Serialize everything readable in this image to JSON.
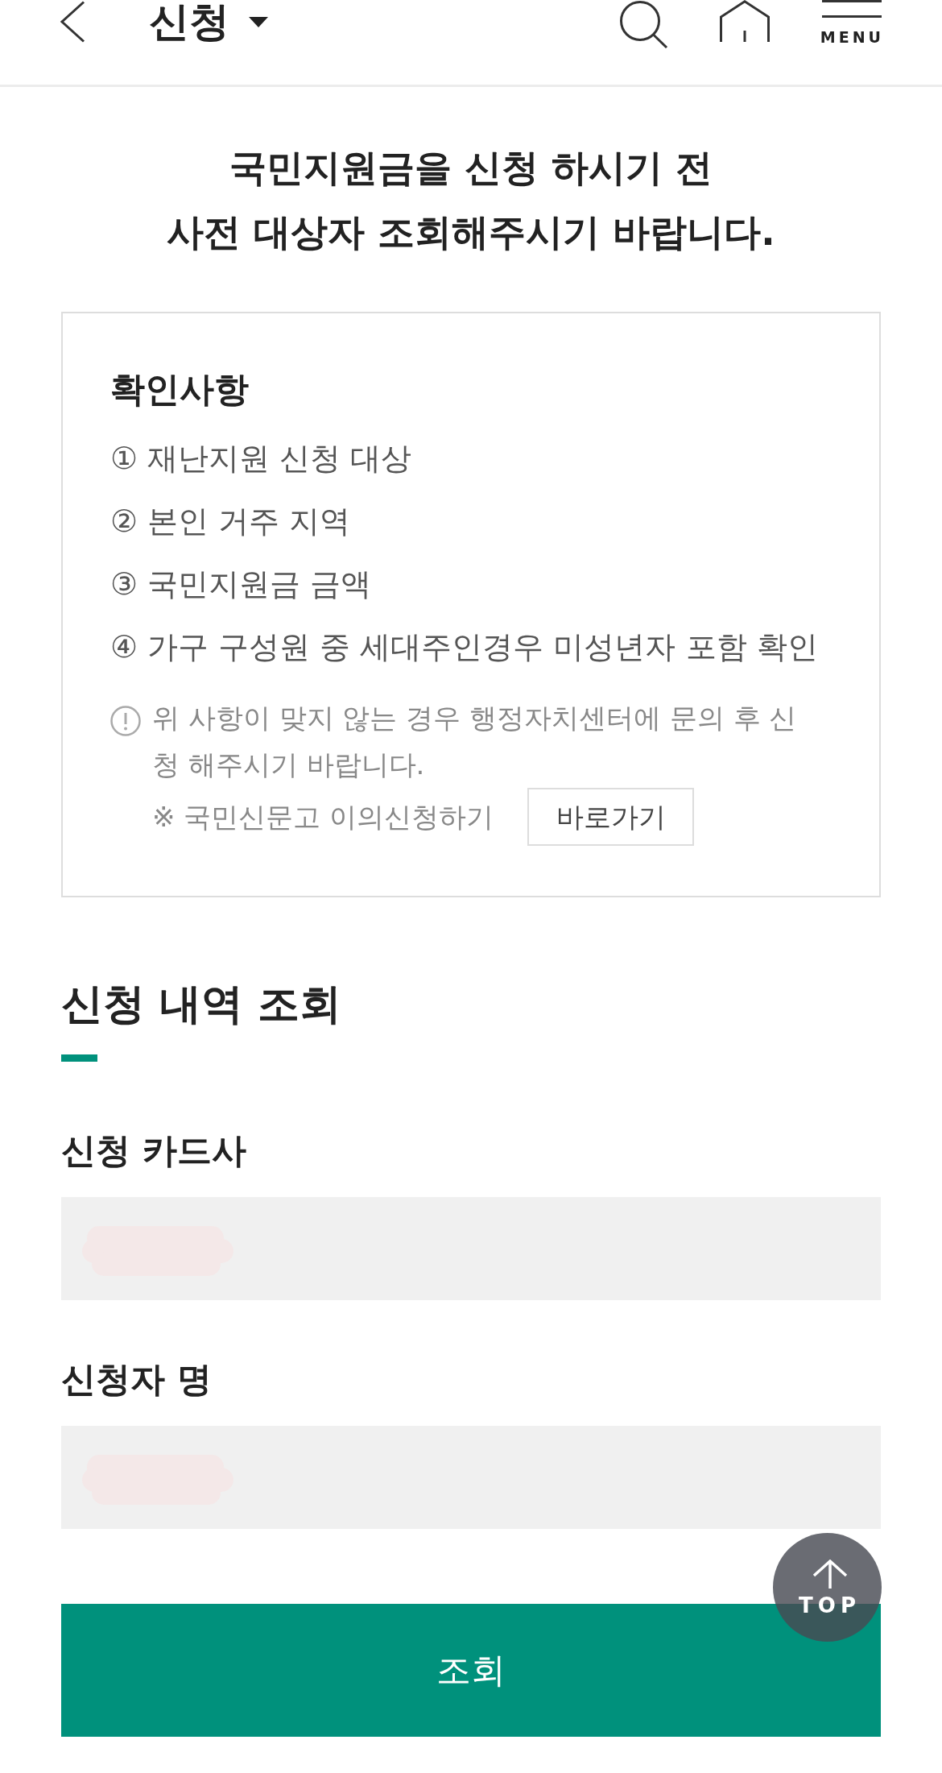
{
  "header": {
    "title": "신청",
    "menu_label": "MENU"
  },
  "intro_lines": [
    "국민지원금을 신청 하시기 전",
    "사전 대상자 조회해주시기 바랍니다."
  ],
  "notice": {
    "title": "확인사항",
    "items": [
      "① 재난지원 신청 대상",
      "② 본인 거주 지역",
      "③ 국민지원금 금액",
      "④ 가구 구성원 중 세대주인경우 미성년자 포함 확인"
    ],
    "note": "위 사항이 맞지 않는 경우 행정자치센터에 문의 후 신청 해주시기 바랍니다.",
    "link_text": "※ 국민신문고 이의신청하기",
    "link_button": "바로가기"
  },
  "section": {
    "title": "신청 내역 조회"
  },
  "fields": [
    {
      "label": "신청 카드사",
      "redacted": true
    },
    {
      "label": "신청자 명",
      "redacted": true
    }
  ],
  "submit_button": "조회",
  "top_button": "TOP"
}
